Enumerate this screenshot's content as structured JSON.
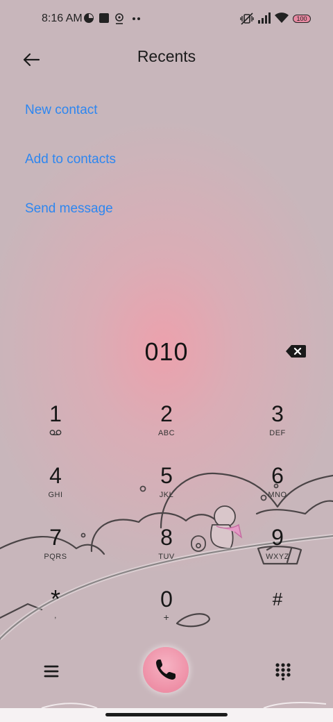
{
  "status_bar": {
    "time": "8:16 AM",
    "icons": [
      "data-saver-icon",
      "app-square-icon",
      "location-pin-icon",
      "more-dots-icon",
      "vibrate-off-icon",
      "signal-icon",
      "wifi-icon",
      "battery-icon"
    ],
    "battery": "100"
  },
  "header": {
    "back_icon": "back-arrow-icon",
    "title": "Recents"
  },
  "actions": {
    "new_contact": "New contact",
    "add_to_contacts": "Add to contacts",
    "send_message": "Send message"
  },
  "dialer": {
    "number": "010",
    "backspace_icon": "backspace-icon",
    "keys": [
      {
        "digit": "1",
        "letters": ""
      },
      {
        "digit": "2",
        "letters": "ABC"
      },
      {
        "digit": "3",
        "letters": "DEF"
      },
      {
        "digit": "4",
        "letters": "GHI"
      },
      {
        "digit": "5",
        "letters": "JKL"
      },
      {
        "digit": "6",
        "letters": "MNO"
      },
      {
        "digit": "7",
        "letters": "PQRS"
      },
      {
        "digit": "8",
        "letters": "TUV"
      },
      {
        "digit": "9",
        "letters": "WXYZ"
      },
      {
        "digit": "*",
        "letters": ","
      },
      {
        "digit": "0",
        "letters": "+"
      },
      {
        "digit": "#",
        "letters": ""
      }
    ]
  },
  "bottom_bar": {
    "menu_icon": "menu-icon",
    "call_icon": "phone-icon",
    "keypad_icon": "dialpad-icon"
  },
  "colors": {
    "link": "#2d86f0",
    "background": "#c8b6bb",
    "glow": "#eea0ac",
    "call_button": "#ee8fa6"
  }
}
